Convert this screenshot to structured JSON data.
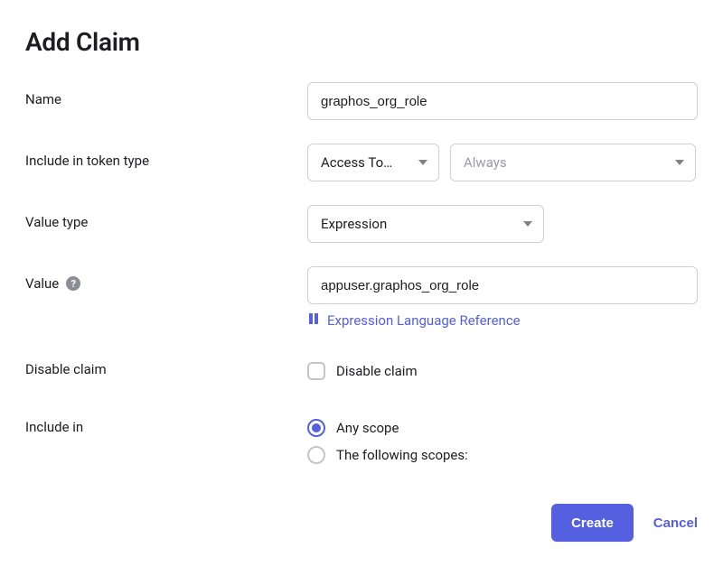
{
  "page": {
    "title": "Add Claim"
  },
  "form": {
    "name": {
      "label": "Name",
      "value": "graphos_org_role"
    },
    "token_type": {
      "label": "Include in token type",
      "select1": "Access To…",
      "select2": "Always"
    },
    "value_type": {
      "label": "Value type",
      "selected": "Expression"
    },
    "value": {
      "label": "Value",
      "value": "appuser.graphos_org_role",
      "reference_link": "Expression Language Reference"
    },
    "disable_claim": {
      "label": "Disable claim",
      "checkbox_label": "Disable claim"
    },
    "include_in": {
      "label": "Include in",
      "option_any": "Any scope",
      "option_following": "The following scopes:"
    }
  },
  "buttons": {
    "create": "Create",
    "cancel": "Cancel"
  },
  "help_glyph": "?"
}
